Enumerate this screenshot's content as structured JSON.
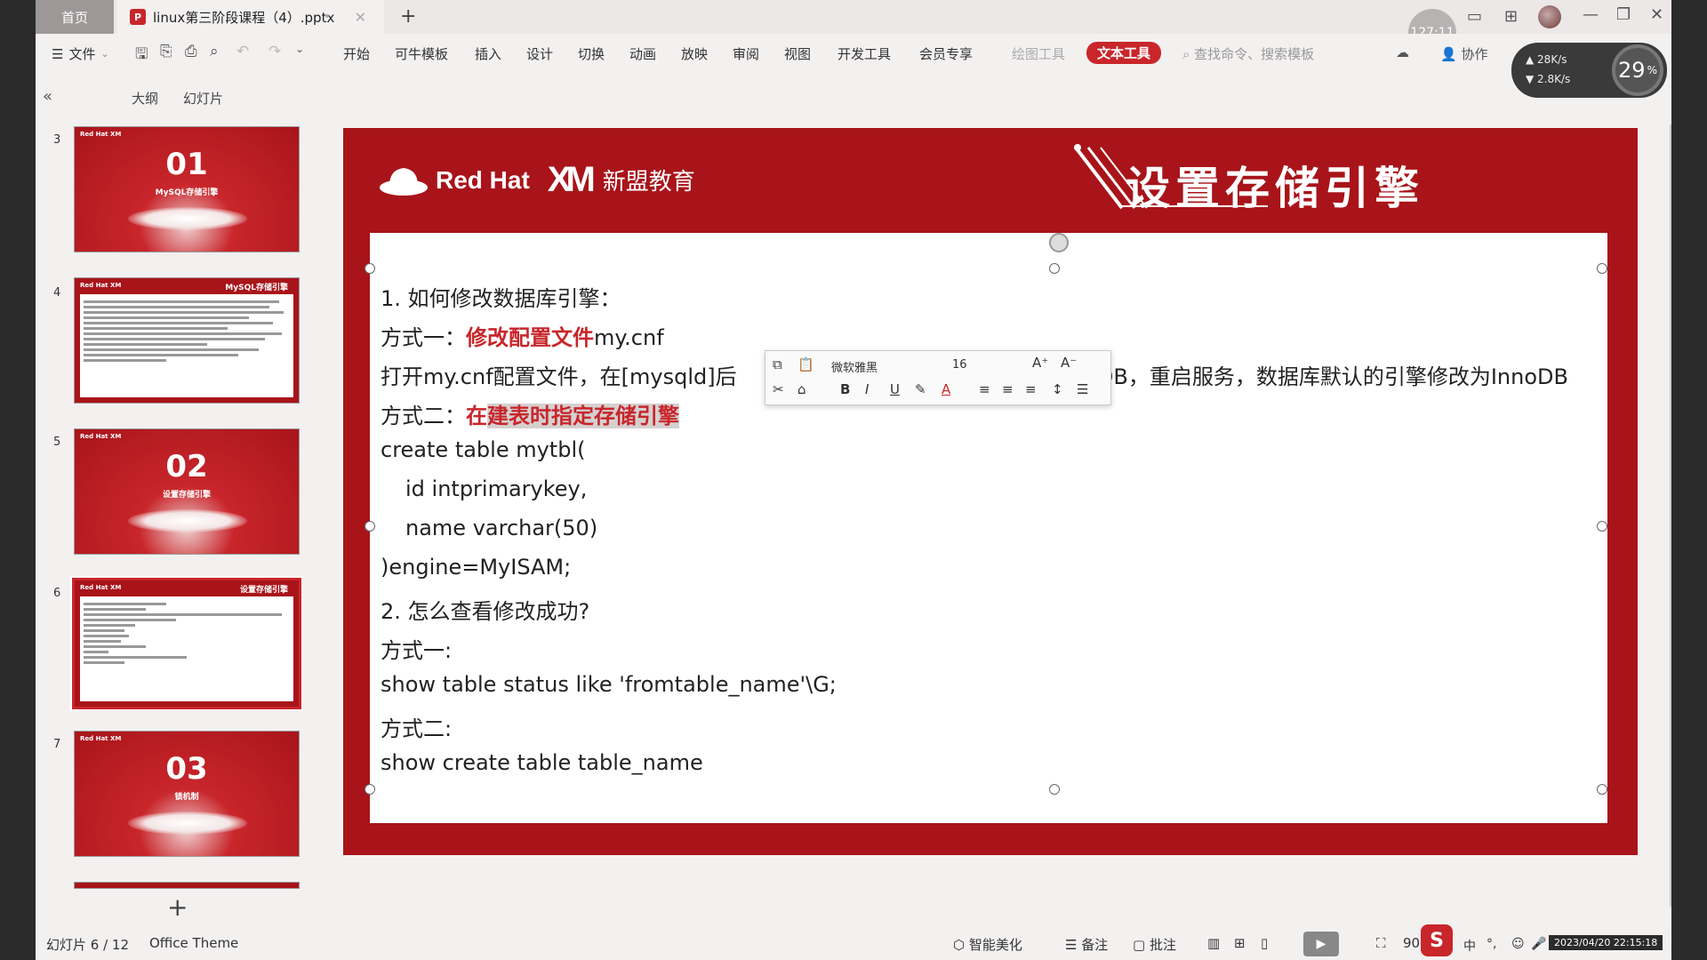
{
  "titlebar": {
    "home_tab": "首页",
    "doc_badge": "P",
    "doc_tab": "linux第三阶段课程（4）.pptx",
    "clock_badge": "127:11"
  },
  "ribbon": {
    "file_menu": "文件",
    "tabs": [
      "开始",
      "可牛模板",
      "插入",
      "设计",
      "切换",
      "动画",
      "放映",
      "审阅",
      "视图",
      "开发工具",
      "会员专享",
      "绘图工具",
      "文本工具"
    ],
    "search_placeholder": "查找命令、搜索模板",
    "collab": "协作"
  },
  "net_widget": {
    "up": "28K/s",
    "down": "2.8K/s",
    "percent": "29",
    "percent_unit": "%"
  },
  "view_tabs": {
    "outline": "大纲",
    "slides": "幻灯片"
  },
  "thumbnails": [
    {
      "num": "3",
      "type": "section",
      "title": "01",
      "subtitle": "MySQL存储引擎"
    },
    {
      "num": "4",
      "type": "text",
      "header": "MySQL存储引擎"
    },
    {
      "num": "5",
      "type": "section",
      "title": "02",
      "subtitle": "设置存储引擎"
    },
    {
      "num": "6",
      "type": "text",
      "header": "设置存储引擎"
    },
    {
      "num": "7",
      "type": "section",
      "title": "03",
      "subtitle": "锁机制"
    }
  ],
  "slide": {
    "logo_redhat": "Red Hat",
    "logo_xm": "XM",
    "logo_xm_text": "新盟教育",
    "title": "设置存储引擎",
    "lines": {
      "l1": "1. 如何修改数据库引擎：",
      "l2a": "方式一：",
      "l2b": "修改配置文件",
      "l2c": "my.cnf",
      "l3a": "打开my.cnf配置文件，在[mysqld]后",
      "l3b": "noDB，重启服务，数据库默认的引擎修改为InnoDB",
      "l4a": "方式二：",
      "l4b": "在",
      "l4c": "建表时指定存储引擎",
      "l5": "create table mytbl(",
      "l6": "id intprimarykey,",
      "l7": "name varchar(50)",
      "l8": ")engine=MyISAM;",
      "l9": "2. 怎么查看修改成功?",
      "l10": "方式一:",
      "l11": "show table status like 'fromtable_name'\\G;",
      "l12": "方式二:",
      "l13": "show create table table_name"
    }
  },
  "format_toolbar": {
    "font": "微软雅黑",
    "size": "16",
    "bold": "B",
    "italic": "I",
    "underline": "U",
    "font_color": "A"
  },
  "statusbar": {
    "slide_index": "幻灯片 6 / 12",
    "theme": "Office Theme",
    "beautify": "智能美化",
    "notes": "备注",
    "comments": "批注",
    "zoom": "90%",
    "ime": "中",
    "datetime": "2023/04/20 22:15:18"
  },
  "colors": {
    "brand_red": "#c8262b",
    "slide_red": "#a8141a"
  }
}
